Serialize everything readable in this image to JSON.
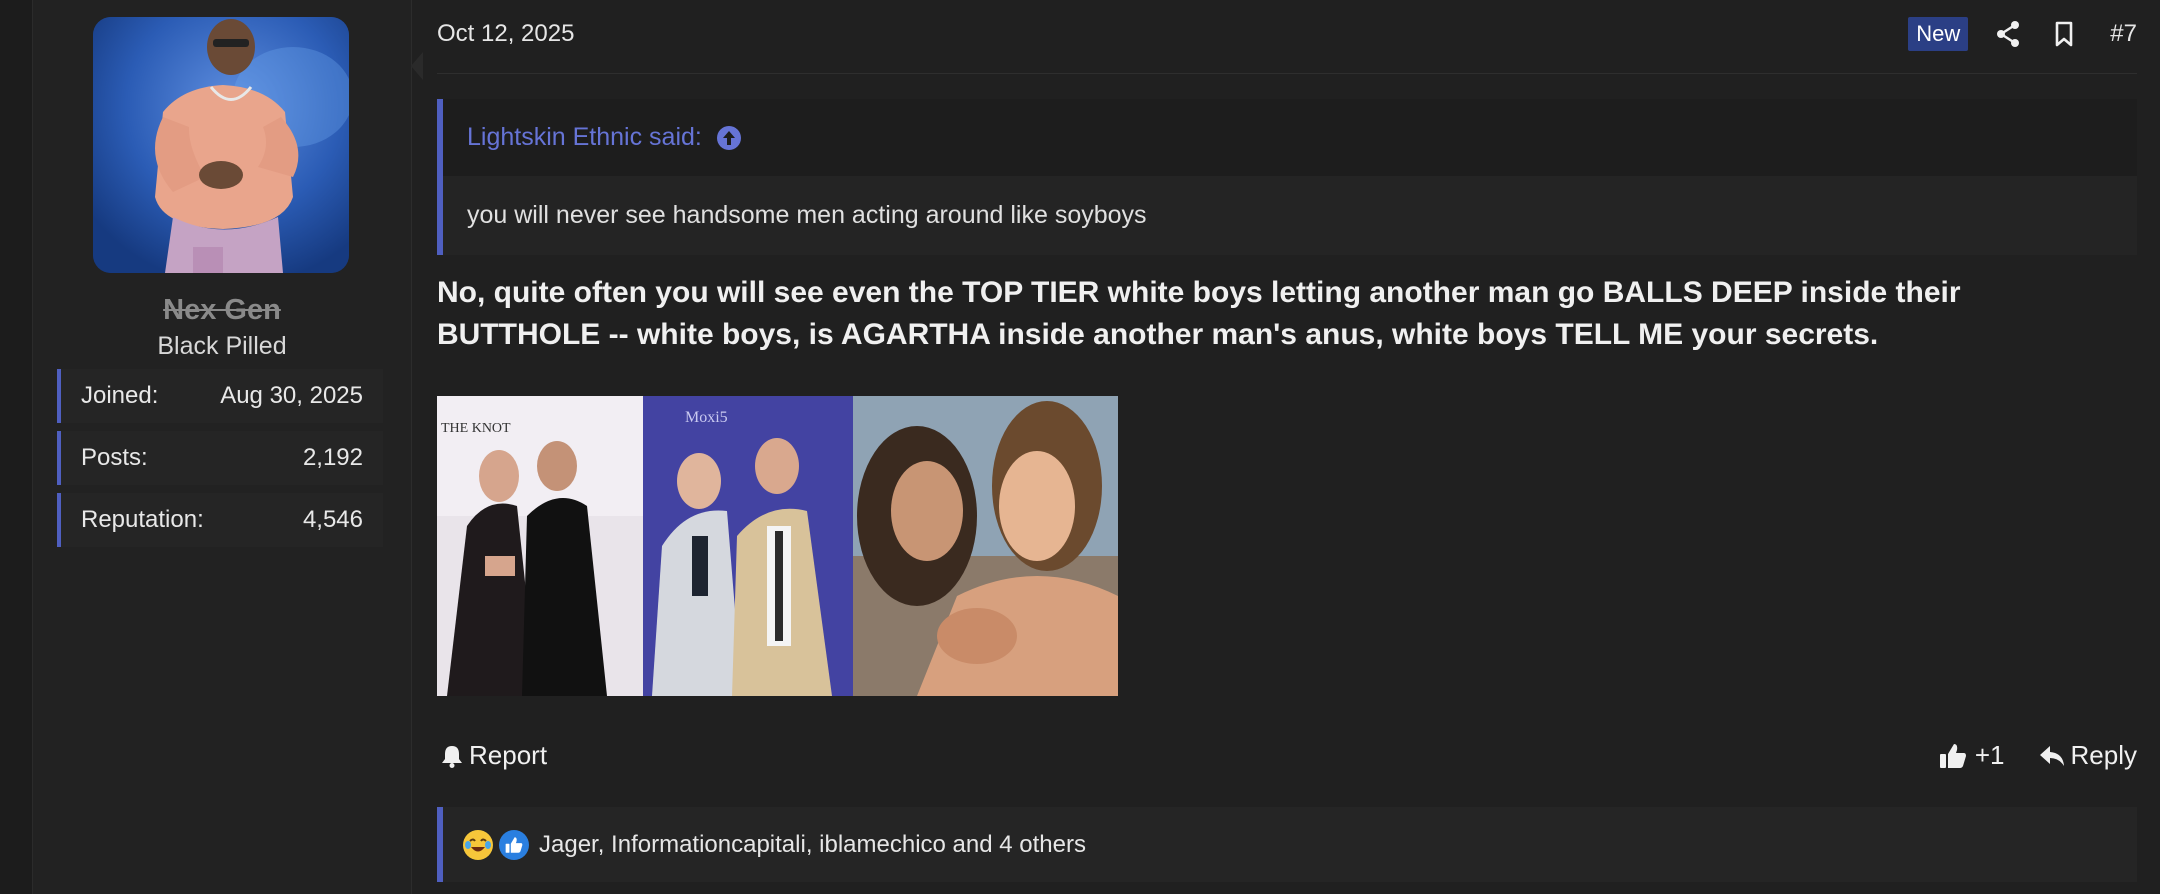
{
  "user": {
    "username": "Nex Gen",
    "title": "Black Pilled",
    "stats": [
      {
        "label": "Joined:",
        "value": "Aug 30, 2025"
      },
      {
        "label": "Posts:",
        "value": "2,192"
      },
      {
        "label": "Reputation:",
        "value": "4,546"
      }
    ]
  },
  "post": {
    "date": "Oct 12, 2025",
    "badge": "New",
    "number": "#7",
    "quote": {
      "author": "Lightskin Ethnic said:",
      "text": "you will never see handsome men acting around like soyboys"
    },
    "message_line1": "No, quite often you will see even the TOP TIER white boys letting another man go BALLS DEEP inside their",
    "message_line2": "BUTTHOLE -- white boys, is AGARTHA inside another man's anus, white boys TELL ME your secrets.",
    "actions": {
      "report": "Report",
      "like_count": "+1",
      "reply": "Reply"
    },
    "reactions": {
      "text": "Jager, Informationcapitali, iblamechico and 4 others"
    }
  },
  "colors": {
    "accent": "#4f5fc0",
    "quote_author": "#6674d6",
    "badge_new": "#2b3f85"
  }
}
